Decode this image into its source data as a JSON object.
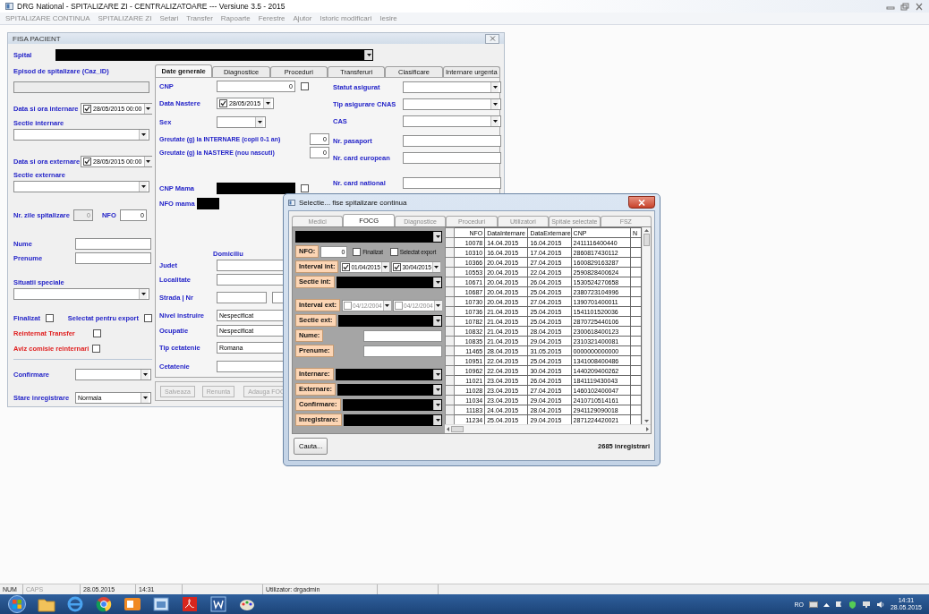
{
  "app_title": "DRG National - SPITALIZARE ZI - CENTRALIZATOARE  --- Versiune 3.5 - 2015",
  "menu": [
    {
      "label": "SPITALIZARE CONTINUA"
    },
    {
      "label": "SPITALIZARE ZI"
    },
    {
      "label": "Setari"
    },
    {
      "label": "Transfer"
    },
    {
      "label": "Rapoarte"
    },
    {
      "label": "Ferestre"
    },
    {
      "label": "Ajutor"
    },
    {
      "label": "Istoric modificari"
    },
    {
      "label": "Iesire"
    }
  ],
  "patient_form": {
    "title": "FISA PACIENT",
    "hospital": {
      "label": "Spital",
      "kind": "redacted_combo"
    },
    "episode": {
      "label": "Episod de spitalizare (Caz_ID)",
      "kind": "readonly"
    },
    "admission": {
      "label": "Data si ora internare",
      "kind": "date",
      "checked": true,
      "value": "28/05/2015 00:00"
    },
    "admission_section": {
      "label": "Sectie internare",
      "kind": "combo"
    },
    "discharge": {
      "label": "Data si ora externare",
      "kind": "date",
      "checked": true,
      "value": "28/05/2015 00:00"
    },
    "discharge_section": {
      "label": "Sectie externare",
      "kind": "combo"
    },
    "stay_days": {
      "label": "Nr. zile spitalizare",
      "kind": "readonly",
      "value": "0"
    },
    "nfo": {
      "label": "NFO",
      "kind": "number",
      "value": "0"
    },
    "last_name": {
      "label": "Nume",
      "kind": "text"
    },
    "first_name": {
      "label": "Prenume",
      "kind": "text"
    },
    "special_situations": {
      "label": "Situatii speciale",
      "kind": "combo"
    },
    "flags": [
      {
        "label": "Finalizat",
        "checked": false,
        "warning": false
      },
      {
        "label": "Selectat pentru export",
        "checked": false,
        "warning": false
      },
      {
        "label": "Reinternat Transfer",
        "checked": false,
        "warning": true
      },
      {
        "label": "Aviz comisie reinternari",
        "checked": false,
        "warning": true
      }
    ],
    "confirmation": {
      "label": "Confirmare",
      "kind": "combo"
    },
    "record_state": {
      "label": "Stare inregistrare",
      "kind": "combo",
      "value": "Normala"
    },
    "tabs": [
      {
        "label": "Date generale",
        "selected": true
      },
      {
        "label": "Diagnostice",
        "selected": false
      },
      {
        "label": "Proceduri",
        "selected": false
      },
      {
        "label": "Transferuri",
        "selected": false
      },
      {
        "label": "Clasificare",
        "selected": false
      },
      {
        "label": "Internare urgenta",
        "selected": false
      }
    ],
    "general": {
      "main": [
        {
          "label": "CNP",
          "kind": "number",
          "value": "0",
          "checkbox": {
            "checked": false
          }
        },
        {
          "label": "Data Nastere",
          "kind": "date",
          "checked": true,
          "value": "28/05/2015"
        },
        {
          "label": "Sex",
          "kind": "combo"
        },
        {
          "label": "Greutate (g) la INTERNARE (copii 0-1 an)",
          "kind": "number",
          "value": "0"
        },
        {
          "label": "Greutate (g) la NASTERE (nou nascuti)",
          "kind": "number",
          "value": "0"
        },
        {
          "label": "CNP Mama",
          "kind": "redacted",
          "checkbox": {
            "checked": false
          }
        },
        {
          "label": "NFO mama",
          "kind": "redacted"
        },
        {
          "label": "Domiciliu",
          "kind": "heading"
        },
        {
          "label": "Judet",
          "kind": "text"
        },
        {
          "label": "Localitate",
          "kind": "text"
        },
        {
          "label": "Strada | Nr",
          "kind": "text_pair"
        },
        {
          "label": "Nivel instruire",
          "kind": "text",
          "value": "Nespecificat"
        },
        {
          "label": "Ocupatie",
          "kind": "text",
          "value": "Nespecificat"
        },
        {
          "label": "Tip cetatenie",
          "kind": "text",
          "value": "Romana"
        },
        {
          "label": "Cetatenie",
          "kind": "text"
        }
      ],
      "side": [
        {
          "label": "Statut asigurat",
          "kind": "combo"
        },
        {
          "label": "Tip asigurare CNAS",
          "kind": "combo"
        },
        {
          "label": "CAS",
          "kind": "combo"
        },
        {
          "label": "Nr. pasaport",
          "kind": "text"
        },
        {
          "label": "Nr. card european",
          "kind": "text"
        },
        {
          "label": "Nr. card national",
          "kind": "text"
        }
      ]
    },
    "buttons": [
      {
        "label": "Salveaza",
        "disabled": true
      },
      {
        "label": "Renunta",
        "disabled": true
      },
      {
        "label": "Adauga FOC",
        "disabled": true
      }
    ]
  },
  "dialog": {
    "title": "Selectie... fise spitalizare continua",
    "tabs": [
      {
        "label": "Medici",
        "selected": false
      },
      {
        "label": "FOCG",
        "selected": true
      },
      {
        "label": "Diagnostice",
        "selected": false
      },
      {
        "label": "Proceduri",
        "selected": false
      },
      {
        "label": "Utilizatori",
        "selected": false
      },
      {
        "label": "Spitale selectate",
        "selected": false
      },
      {
        "label": "FSZ",
        "selected": false
      }
    ],
    "filters": [
      {
        "kind": "redacted_combo"
      },
      {
        "kind": "nfo",
        "label": "NFO:",
        "value": "0",
        "options": [
          {
            "label": "Finalizat",
            "checked": false
          },
          {
            "label": "Selectat export",
            "checked": false
          }
        ]
      },
      {
        "kind": "interval",
        "label": "Interval int:",
        "disabled": false,
        "dates": [
          {
            "value": "01/04/2015",
            "checked": true
          },
          {
            "value": "30/04/2015",
            "checked": true
          }
        ]
      },
      {
        "kind": "redacted_combo",
        "label": "Sectie int:"
      },
      {
        "kind": "interval",
        "label": "Interval ext:",
        "disabled": true,
        "dates": [
          {
            "value": "04/12/2004",
            "checked": false
          },
          {
            "value": "04/12/2004",
            "checked": false
          }
        ]
      },
      {
        "kind": "redacted_combo",
        "label": "Sectie ext:"
      },
      {
        "kind": "text",
        "label": "Nume:"
      },
      {
        "kind": "text",
        "label": "Prenume:"
      },
      {
        "kind": "redacted_combo",
        "label": "Internare:"
      },
      {
        "kind": "redacted_combo",
        "label": "Externare:"
      },
      {
        "kind": "redacted_combo",
        "label": "Confirmare:"
      },
      {
        "kind": "redacted_combo",
        "label": "Inregistrare:"
      }
    ],
    "table": {
      "columns": [
        "NFO",
        "DataInternare",
        "DataExternare",
        "CNP",
        "N"
      ],
      "rows": [
        [
          "10078",
          "14.04.2015",
          "16.04.2015",
          "2411116400440"
        ],
        [
          "10310",
          "16.04.2015",
          "17.04.2015",
          "2860817430112"
        ],
        [
          "10366",
          "20.04.2015",
          "27.04.2015",
          "1600829163287"
        ],
        [
          "10553",
          "20.04.2015",
          "22.04.2015",
          "2590828400624"
        ],
        [
          "10671",
          "20.04.2015",
          "26.04.2015",
          "1530524270658"
        ],
        [
          "10687",
          "20.04.2015",
          "25.04.2015",
          "2380723104996"
        ],
        [
          "10730",
          "20.04.2015",
          "27.04.2015",
          "1390701400011"
        ],
        [
          "10736",
          "21.04.2015",
          "25.04.2015",
          "1541101520036"
        ],
        [
          "10782",
          "21.04.2015",
          "25.04.2015",
          "2870725440106"
        ],
        [
          "10832",
          "21.04.2015",
          "28.04.2015",
          "2300618400123"
        ],
        [
          "10835",
          "21.04.2015",
          "29.04.2015",
          "2310321400081"
        ],
        [
          "11465",
          "28.04.2015",
          "31.05.2015",
          "0000000000000"
        ],
        [
          "10951",
          "22.04.2015",
          "25.04.2015",
          "1341008400486"
        ],
        [
          "10962",
          "22.04.2015",
          "30.04.2015",
          "1440209400262"
        ],
        [
          "11021",
          "23.04.2015",
          "26.04.2015",
          "1841119430043"
        ],
        [
          "11028",
          "23.04.2015",
          "27.04.2015",
          "1460102400047"
        ],
        [
          "11034",
          "23.04.2015",
          "29.04.2015",
          "2410710514161"
        ],
        [
          "11183",
          "24.04.2015",
          "28.04.2015",
          "2941129090018"
        ],
        [
          "11234",
          "25.04.2015",
          "29.04.2015",
          "2871224420021"
        ]
      ]
    },
    "search_button": "Cauta...",
    "count": "2685 inregistrari"
  },
  "status_bar": [
    {
      "label": "NUM",
      "on": true
    },
    {
      "label": "CAPS",
      "on": false
    },
    {
      "label": "28.05.2015"
    },
    {
      "label": "14:31"
    },
    {
      "label": "Utilizator: drgadmin"
    }
  ],
  "tray": {
    "language": "RO",
    "time": "14:31",
    "date": "28.05.2015"
  }
}
